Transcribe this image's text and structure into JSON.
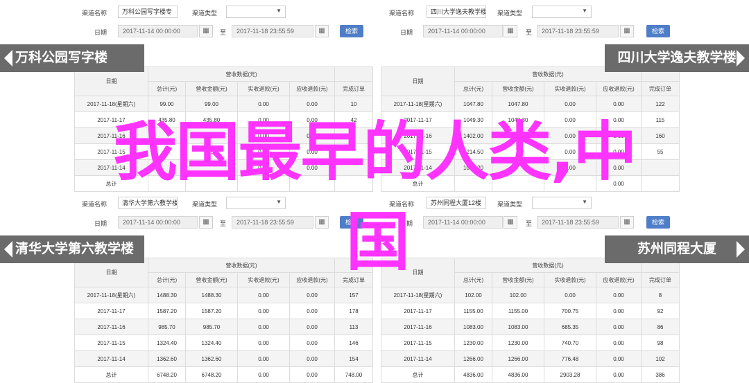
{
  "common": {
    "channel_label": "渠道名称",
    "type_label": "渠道类型",
    "date_label": "日期",
    "to_label": "至",
    "query_button": "检索",
    "headers": {
      "date": "日期",
      "revenue_group": "营收数据(元)",
      "total": "总计(元)",
      "rev_amount": "营收金额(元)",
      "refund_amount": "实收退款(元)",
      "refund_profit": "应收退款(元)",
      "orders": "完成订单"
    }
  },
  "panels": [
    {
      "channel_value": "万科公园写字楼专",
      "date_from": "2017-11-14 00:00:00",
      "date_to": "2017-11-18 23:55:59",
      "banner": "万科公园写字楼",
      "rows": [
        [
          "2017-11-18(星期六)",
          "99.00",
          "99.00",
          "0.00",
          "0.00",
          "10"
        ],
        [
          "2017-11-17",
          "435.80",
          "435.80",
          "0.00",
          "0.00",
          "42"
        ],
        [
          "2017-11-16",
          "",
          "",
          "0.00",
          "0.00",
          ""
        ],
        [
          "2017-11-15",
          "",
          "1.50",
          "0.00",
          "0.00",
          ""
        ],
        [
          "2017-11-14",
          "",
          "",
          "0.00",
          "0.00",
          ""
        ],
        [
          "总计",
          "",
          "",
          "",
          "",
          ""
        ]
      ]
    },
    {
      "channel_value": "四川大学逸夫教学楼",
      "date_from": "2017-11-14 00:00:00",
      "date_to": "2017-11-18 23:55:59",
      "banner": "四川大学逸夫教学楼",
      "rows": [
        [
          "2017-11-18(星期六)",
          "1047.80",
          "1047.80",
          "0.00",
          "0.00",
          "122"
        ],
        [
          "2017-11-17",
          "1049.30",
          "1049.30",
          "0.00",
          "0.00",
          "115"
        ],
        [
          "2017-11-16",
          "1402.00",
          "1402",
          "0.00",
          "0.00",
          "160"
        ],
        [
          "2017-11-15",
          "1214.50",
          "",
          "0.00",
          "0.00",
          "55"
        ],
        [
          "2017-11-14",
          "1076.20",
          "",
          "0.00",
          "0.00",
          ""
        ],
        [
          "总计",
          "",
          "",
          "",
          "0.00",
          ""
        ]
      ]
    },
    {
      "channel_value": "清华大学第六教学楼",
      "date_from": "2017-11-14 00:00:00",
      "date_to": "2017-11-18 23:55:59",
      "banner": "清华大学第六教学楼",
      "rows": [
        [
          "2017-11-18(星期六)",
          "1488.30",
          "1488.30",
          "0.00",
          "0.00",
          "157"
        ],
        [
          "2017-11-17",
          "1587.20",
          "1587.20",
          "0.00",
          "0.00",
          "178"
        ],
        [
          "2017-11-16",
          "985.70",
          "985.70",
          "0.00",
          "0.00",
          "113"
        ],
        [
          "2017-11-15",
          "1324.40",
          "1324.40",
          "0.00",
          "0.00",
          "146"
        ],
        [
          "2017-11-14",
          "1362.60",
          "1362.60",
          "0.00",
          "0.00",
          "154"
        ],
        [
          "总计",
          "6748.20",
          "6748.20",
          "0.00",
          "0.00",
          "748.00"
        ]
      ]
    },
    {
      "channel_value": "苏州同程大厦12楼",
      "date_from": "2017-11-14 00:00:00",
      "date_to": "2017-11-18 23:55:59",
      "banner": "苏州同程大厦",
      "rows": [
        [
          "2017-11-18(星期六)",
          "102.00",
          "102.00",
          "0.00",
          "0.00",
          "8"
        ],
        [
          "2017-11-17",
          "1155.00",
          "1155.00",
          "700.75",
          "0.00",
          "92"
        ],
        [
          "2017-11-16",
          "1083.00",
          "1083.00",
          "685.35",
          "0.00",
          "86"
        ],
        [
          "2017-11-15",
          "1230.00",
          "1230.00",
          "740.70",
          "0.00",
          "98"
        ],
        [
          "2017-11-14",
          "1266.00",
          "1266.00",
          "776.48",
          "0.00",
          "102"
        ],
        [
          "总计",
          "4836.00",
          "4836.00",
          "2903.28",
          "0.00",
          "386"
        ]
      ]
    }
  ],
  "overlay": {
    "line1": "我国最早的人类,中",
    "line2": "国"
  },
  "colors": {
    "banner_bg": "#6b6b6b",
    "query_button_bg": "#4f7ec8",
    "overlay_text": "#ff33ff"
  }
}
